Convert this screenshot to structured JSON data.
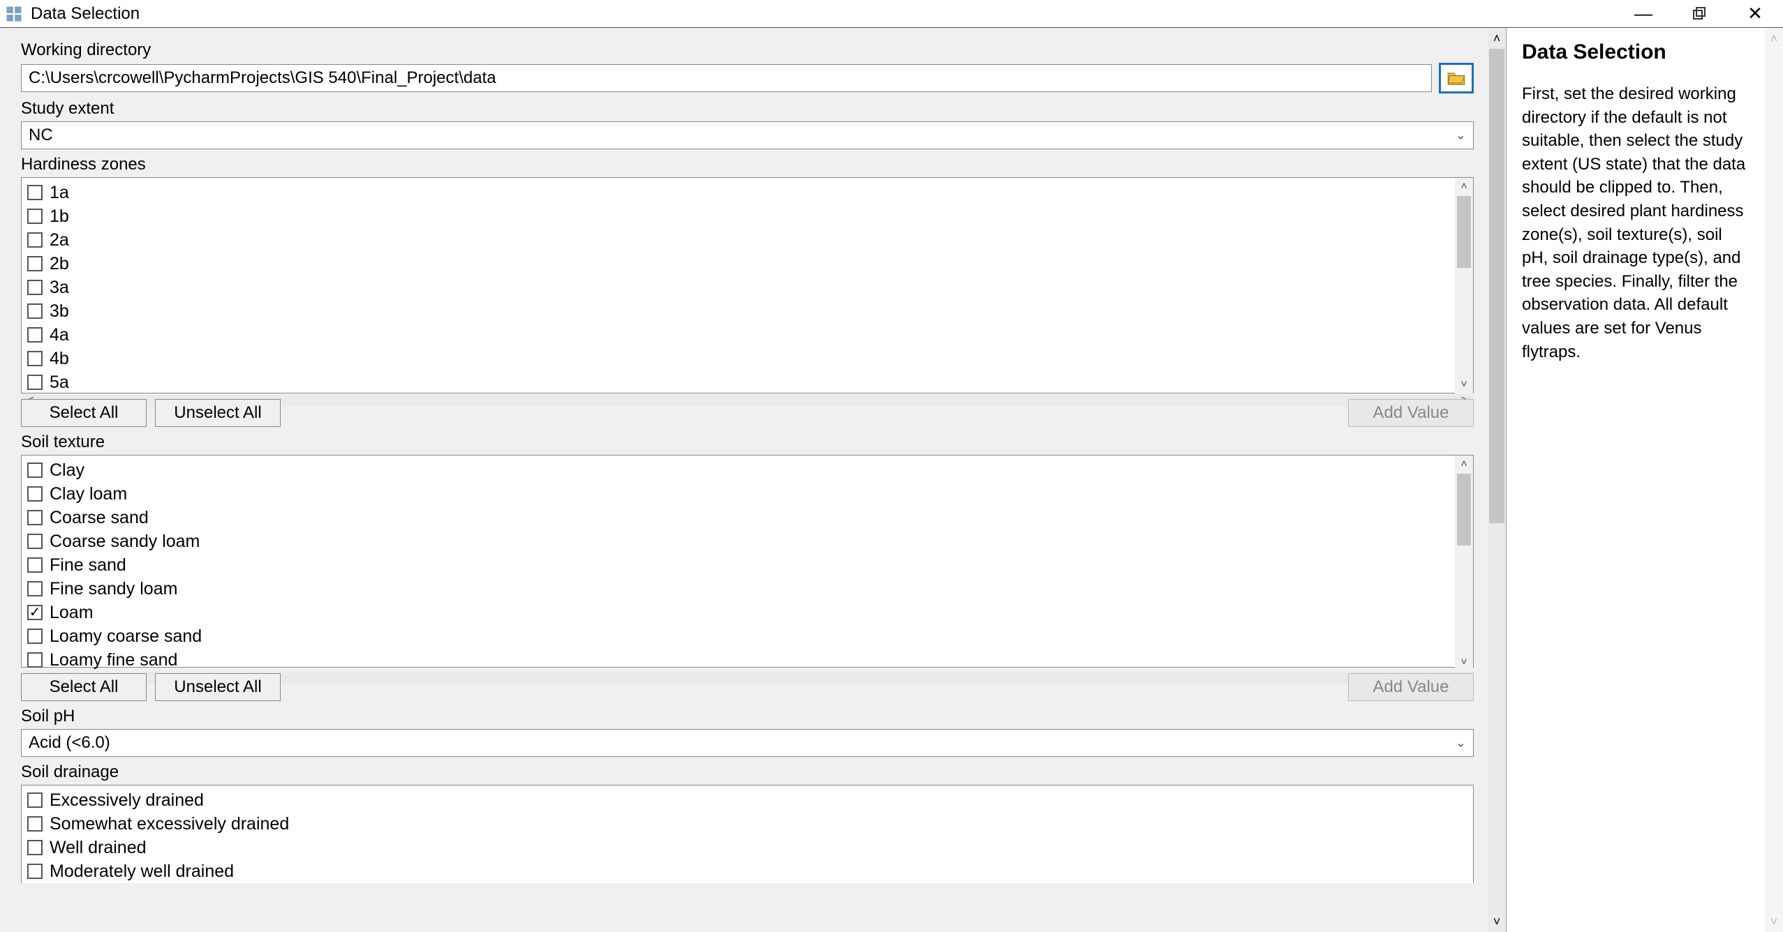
{
  "window": {
    "title": "Data Selection",
    "minimize": "—",
    "maximize": "▢",
    "close": "✕"
  },
  "labels": {
    "working_directory": "Working directory",
    "study_extent": "Study extent",
    "hardiness_zones": "Hardiness zones",
    "soil_texture": "Soil texture",
    "soil_ph": "Soil pH",
    "soil_drainage": "Soil drainage"
  },
  "values": {
    "working_directory": "C:\\Users\\crcowell\\PycharmProjects\\GIS 540\\Final_Project\\data",
    "study_extent": "NC",
    "soil_ph": "Acid (<6.0)"
  },
  "hardiness_items": [
    {
      "label": "1a",
      "checked": false
    },
    {
      "label": "1b",
      "checked": false
    },
    {
      "label": "2a",
      "checked": false
    },
    {
      "label": "2b",
      "checked": false
    },
    {
      "label": "3a",
      "checked": false
    },
    {
      "label": "3b",
      "checked": false
    },
    {
      "label": "4a",
      "checked": false
    },
    {
      "label": "4b",
      "checked": false
    },
    {
      "label": "5a",
      "checked": false
    }
  ],
  "soil_texture_items": [
    {
      "label": "Clay",
      "checked": false
    },
    {
      "label": "Clay loam",
      "checked": false
    },
    {
      "label": "Coarse sand",
      "checked": false
    },
    {
      "label": "Coarse sandy loam",
      "checked": false
    },
    {
      "label": "Fine sand",
      "checked": false
    },
    {
      "label": "Fine sandy loam",
      "checked": false
    },
    {
      "label": "Loam",
      "checked": true
    },
    {
      "label": "Loamy coarse sand",
      "checked": false
    },
    {
      "label": "Loamy fine sand",
      "checked": false
    }
  ],
  "soil_drainage_items": [
    {
      "label": "Excessively drained",
      "checked": false
    },
    {
      "label": "Somewhat excessively drained",
      "checked": false
    },
    {
      "label": "Well drained",
      "checked": false
    },
    {
      "label": "Moderately well drained",
      "checked": false
    }
  ],
  "buttons": {
    "select_all": "Select All",
    "unselect_all": "Unselect All",
    "add_value": "Add Value"
  },
  "help": {
    "title": "Data Selection",
    "body": "First, set the desired working directory if the default is not suitable, then select the study extent (US state) that the data should be clipped to. Then, select desired plant hardiness zone(s), soil texture(s), soil pH, soil drainage type(s), and tree species. Finally, filter the observation data. All default values are set for Venus flytraps."
  }
}
